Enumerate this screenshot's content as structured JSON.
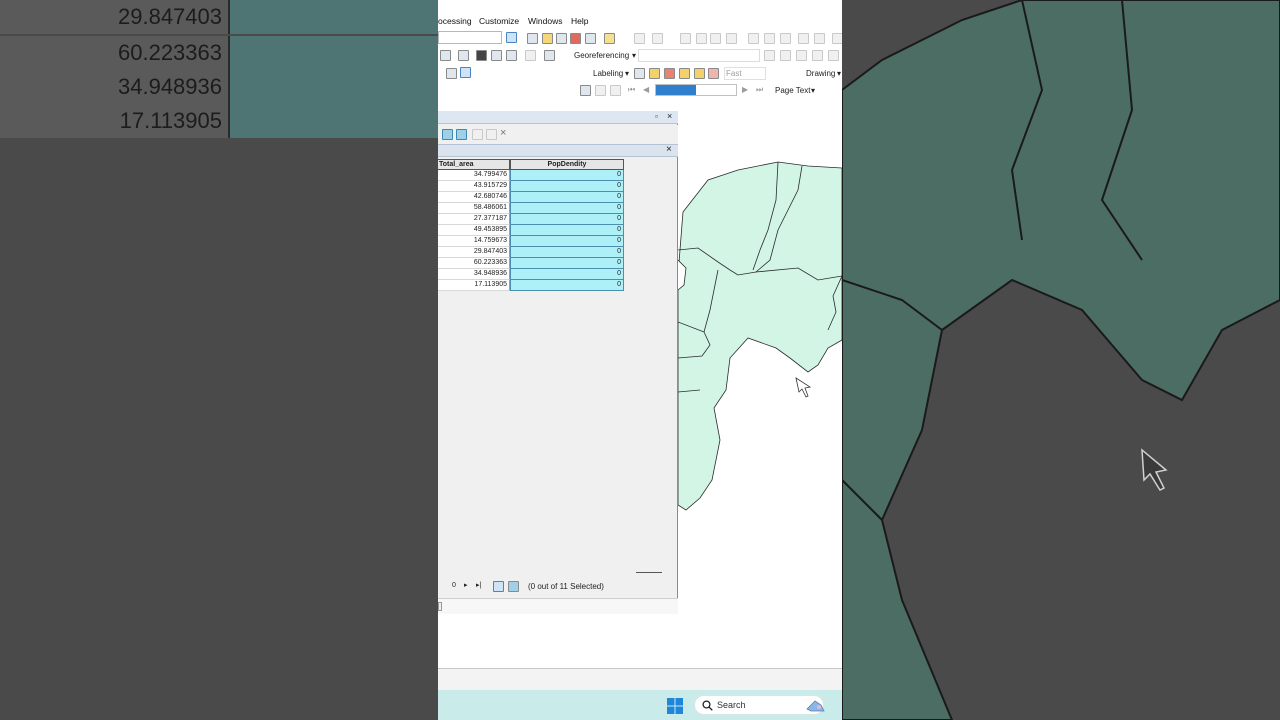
{
  "zoomed_table": {
    "rows": [
      "29.847403",
      "60.223363",
      "34.948936",
      "17.113905"
    ]
  },
  "menu": {
    "items": [
      "ocessing",
      "Customize",
      "Windows",
      "Help"
    ]
  },
  "toolbars": {
    "georeferencing_label": "Georeferencing",
    "labeling_label": "Labeling",
    "fast_label": "Fast",
    "drawing_label": "Drawing",
    "page_text_label": "Page Text"
  },
  "table_window": {
    "columns": [
      "Total_area",
      "PopDendity"
    ],
    "rows": [
      {
        "total_area": "34.799476",
        "pop_dendity": "0"
      },
      {
        "total_area": "43.915729",
        "pop_dendity": "0"
      },
      {
        "total_area": "42.680746",
        "pop_dendity": "0"
      },
      {
        "total_area": "58.486061",
        "pop_dendity": "0"
      },
      {
        "total_area": "27.377187",
        "pop_dendity": "0"
      },
      {
        "total_area": "49.453895",
        "pop_dendity": "0"
      },
      {
        "total_area": "14.759673",
        "pop_dendity": "0"
      },
      {
        "total_area": "29.847403",
        "pop_dendity": "0"
      },
      {
        "total_area": "60.223363",
        "pop_dendity": "0"
      },
      {
        "total_area": "34.948936",
        "pop_dendity": "0"
      },
      {
        "total_area": "17.113905",
        "pop_dendity": "0"
      }
    ],
    "nav_record": "0",
    "selection_status": "(0 out of 11 Selected)"
  },
  "map": {
    "fill_color": "#d2f5e6",
    "line_color": "#2a2a2a"
  },
  "taskbar": {
    "search_placeholder": "Search",
    "background": "#c9ecea"
  },
  "colors": {
    "highlight_cell": "#aef0f8",
    "zoom_highlight": "#4f7474"
  }
}
